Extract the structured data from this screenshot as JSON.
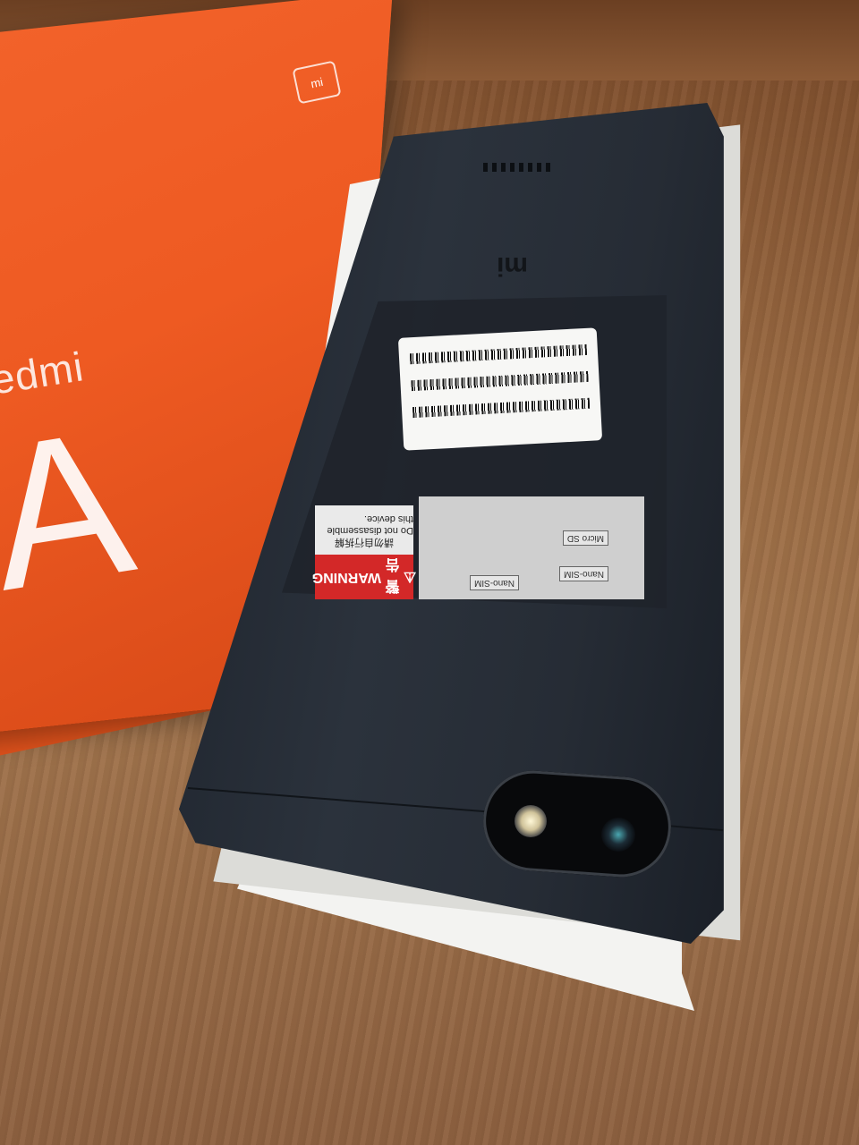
{
  "box": {
    "brand_text": "edmi",
    "model_text": "A",
    "logo_text": "mi"
  },
  "phone": {
    "back_logo": "mi",
    "warning": {
      "cn_title": "警告",
      "en_title": "WARNING",
      "cn_text": "請勿自行拆解",
      "en_text": "Do not disassemble this device."
    },
    "sim_tray": {
      "slot1": "Nano-SIM",
      "slot2": "Nano-SIM",
      "slot3": "Micro SD"
    }
  }
}
